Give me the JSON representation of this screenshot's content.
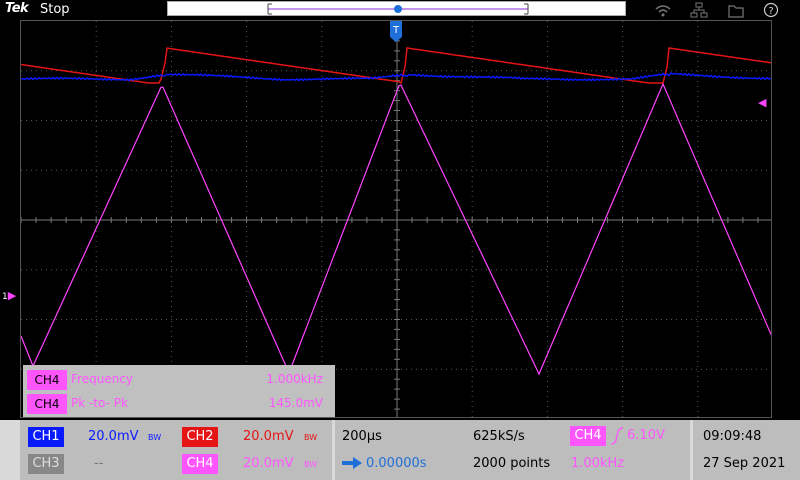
{
  "header": {
    "brand": "Tek",
    "run_state": "Stop"
  },
  "icons": [
    "wifi-icon",
    "network-icon",
    "folder-icon",
    "help-icon"
  ],
  "colors": {
    "ch1": "#0a1aff",
    "ch2": "#e51515",
    "ch3": "#888888",
    "ch4": "#ff55ff"
  },
  "trigger_marker": "T",
  "channel_marker": "1",
  "measurements": [
    {
      "channel": "CH4",
      "name": "Frequency",
      "value": "1.000kHz"
    },
    {
      "channel": "CH4",
      "name": "Pk -to- Pk",
      "value": "145.0mV"
    }
  ],
  "vertical": {
    "ch1": {
      "label": "CH1",
      "scale": "20.0mV",
      "bw": "BW"
    },
    "ch2": {
      "label": "CH2",
      "scale": "20.0mV",
      "bw": "BW"
    },
    "ch3": {
      "label": "CH3",
      "scale": "--"
    },
    "ch4": {
      "label": "CH4",
      "scale": "20.0mV",
      "bw": "BW"
    }
  },
  "horizontal": {
    "timebase": "200µs",
    "delay": "0.00000s",
    "sample_rate": "625kS/s",
    "record_length": "2000 points"
  },
  "trigger": {
    "source": "CH4",
    "level": "6.10V",
    "frequency": "1.00kHz"
  },
  "clock": {
    "time": "09:09:48",
    "date": "27 Sep 2021"
  }
}
